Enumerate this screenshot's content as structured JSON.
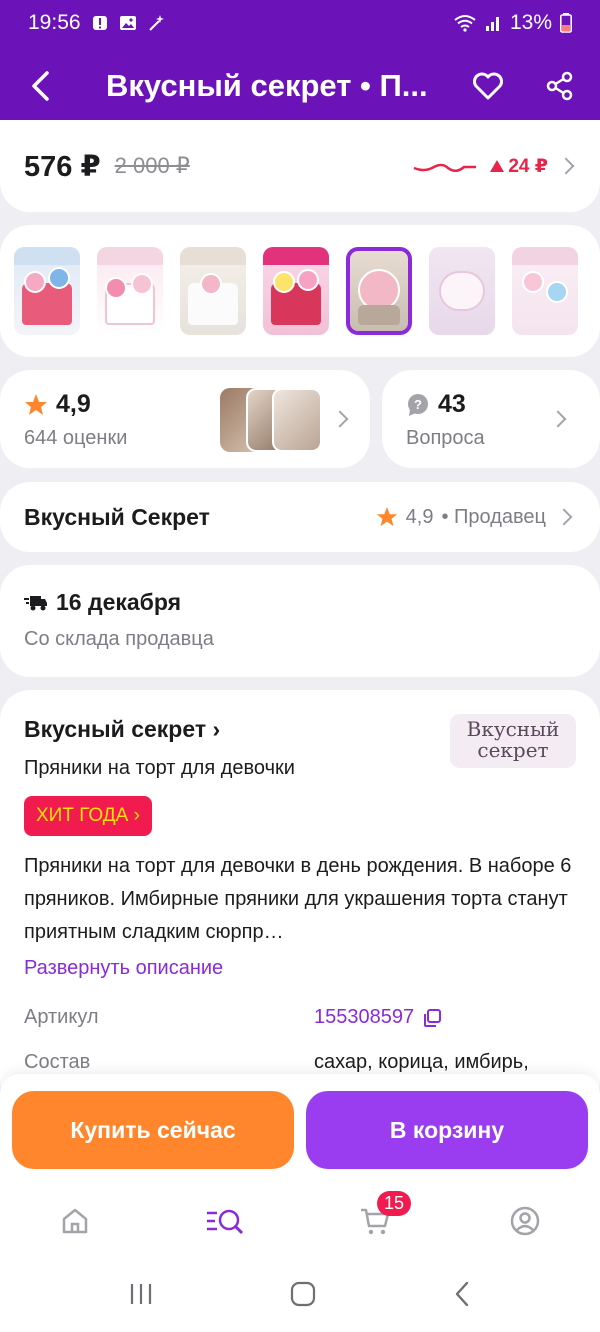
{
  "status_bar": {
    "time": "19:56",
    "battery": "13%",
    "icons": [
      "alert-icon",
      "image-icon",
      "magic-wand-icon",
      "wifi-icon",
      "signal-icon",
      "battery-icon"
    ]
  },
  "app_bar": {
    "title": "Вкусный секрет • П...",
    "icons": [
      "back-arrow-icon",
      "heart-icon",
      "share-icon"
    ]
  },
  "price": {
    "current": "576 ₽",
    "old": "2 000 ₽",
    "delta": "24 ₽",
    "trend_color": "#e8244a"
  },
  "gallery": {
    "thumbnail_count": 7,
    "selected_index": 4
  },
  "rating": {
    "value": "4,9",
    "count_label": "644 оценки"
  },
  "questions": {
    "count": "43",
    "label": "Вопроса"
  },
  "seller": {
    "name": "Вкусный Секрет",
    "rating": "4,9",
    "role": "• Продавец"
  },
  "delivery": {
    "date": "16 декабря",
    "source": "Со склада продавца"
  },
  "product": {
    "brand": "Вкусный секрет ›",
    "name": "Пряники на торт для девочки",
    "badge": "ХИТ ГОДА ›",
    "description": "Пряники на торт для девочки в день рождения. В наборе 6 пряников. Имбирные пряники для украшения торта станут приятным сладким сюрпр…",
    "expand_label": "Развернуть описание",
    "logo_line1": "Вкусный",
    "logo_line2": "секрет",
    "specs": [
      {
        "key": "Артикул",
        "value": "155308597"
      },
      {
        "key": "Состав",
        "value": "сахар, корица, имбирь,"
      }
    ]
  },
  "actions": {
    "buy_now": "Купить сейчас",
    "add_to_cart": "В корзину"
  },
  "bottom_nav": {
    "cart_badge": "15",
    "items": [
      "home-icon",
      "catalog-search-icon",
      "cart-icon",
      "profile-icon"
    ]
  },
  "colors": {
    "primary": "#6b13b8",
    "accent": "#8b2ad8",
    "buy_button": "#ff862d",
    "cart_button": "#9a3cf0",
    "hit_badge": "#f21b4f"
  }
}
